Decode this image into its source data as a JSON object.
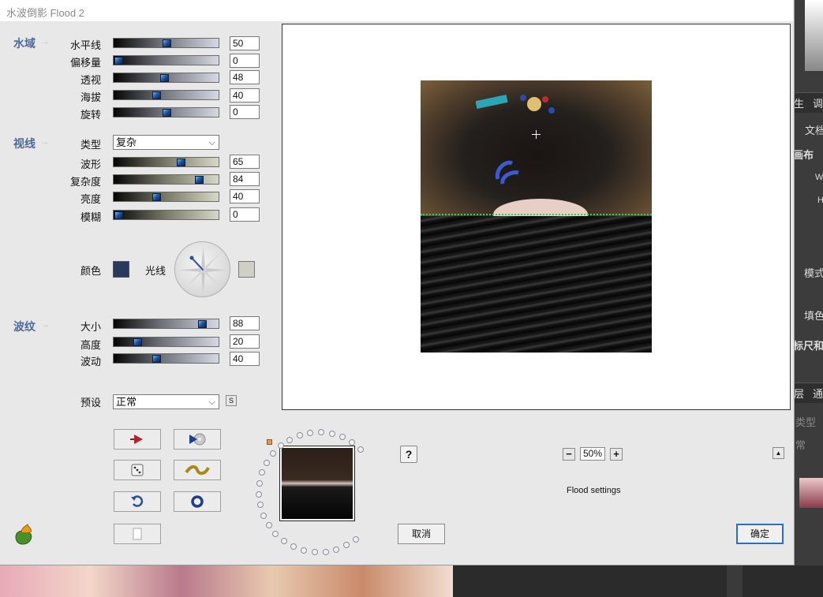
{
  "dialog": {
    "title": "水波倒影 Flood 2"
  },
  "sections": {
    "horizon": "水域",
    "view": "视线",
    "waves": "波纹"
  },
  "horizon_params": [
    {
      "label": "水平线",
      "value": "50",
      "level": 50
    },
    {
      "label": "偏移量",
      "value": "0",
      "level": 0
    },
    {
      "label": "透视",
      "value": "48",
      "level": 48
    },
    {
      "label": "海拔",
      "value": "40",
      "level": 40
    },
    {
      "label": "旋转",
      "value": "0",
      "level": 50
    }
  ],
  "view": {
    "type_label": "类型",
    "type_value": "复杂",
    "params": [
      {
        "label": "波形",
        "value": "65",
        "level": 65
      },
      {
        "label": "复杂度",
        "value": "84",
        "level": 84
      },
      {
        "label": "亮度",
        "value": "40",
        "level": 40
      },
      {
        "label": "模糊",
        "value": "0",
        "level": 0
      }
    ],
    "color_label": "颜色",
    "light_label": "光线",
    "colors": {
      "water": "#2a3a5e",
      "light": "#cfcfc4"
    }
  },
  "waves_params": [
    {
      "label": "大小",
      "value": "88",
      "level": 88
    },
    {
      "label": "高度",
      "value": "20",
      "level": 20
    },
    {
      "label": "波动",
      "value": "40",
      "level": 40
    }
  ],
  "preset": {
    "label": "预设",
    "value": "正常",
    "save_icon": "S"
  },
  "buttons": {
    "cancel": "取消",
    "ok": "确定",
    "help": "?"
  },
  "zoom": {
    "minus": "−",
    "value": "50%",
    "plus": "+"
  },
  "status": "Flood settings",
  "host": {
    "labels": [
      "生",
      "调",
      "文档",
      "画布",
      "W",
      "H",
      "模式",
      "填色",
      "标尺和",
      "层",
      "通",
      "类型",
      "常"
    ]
  }
}
